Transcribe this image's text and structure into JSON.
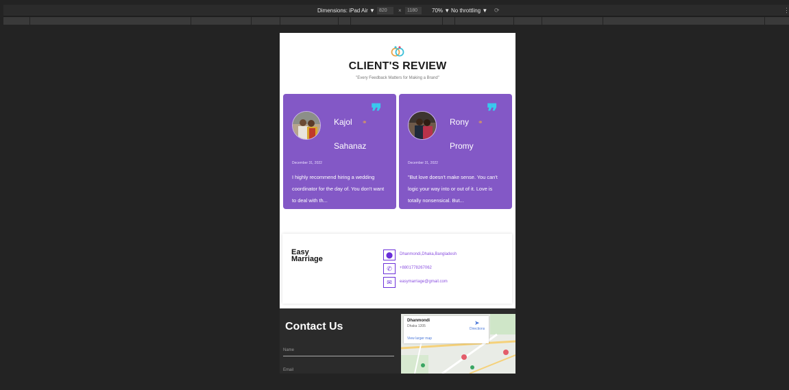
{
  "toolbar": {
    "dimensions": "Dimensions: iPad Air ▼",
    "width": "820",
    "times": "×",
    "height": "1180",
    "zoom": "70% ▼",
    "throttling": "No throttling ▼",
    "more": "⋮"
  },
  "review": {
    "title": "CLIENT'S REVIEW",
    "subtitle": "\"Every Feedback Matters for Making a Brand\"",
    "cards": [
      {
        "first_name": "Kajol",
        "second_name": "Sahanaz",
        "date": "December 31, 2022",
        "text": "I highly recommend hiring a wedding coordinator for the day of. You don't want to deal with th..."
      },
      {
        "first_name": "Rony",
        "second_name": "Promy",
        "date": "December 31, 2022",
        "text": "\"But love doesn't make sense. You can't logic your way into or out of it. Love is totally nonsensical. But..."
      }
    ]
  },
  "footer": {
    "brand_line1": "Easy",
    "brand_line2": "Marriage",
    "address": "Dhanmondi,Dhaka,Bangladesh",
    "phone": "+8801778267062",
    "email": "easymarriage@gmail.com"
  },
  "contact": {
    "title": "Contact Us",
    "name_placeholder": "Name",
    "email_placeholder": "Email"
  },
  "map": {
    "place": "Dhanmondi",
    "area": "Dhaka 1205",
    "directions": "Directions",
    "larger_map": "View larger map"
  },
  "colors": {
    "card": "#8358c6",
    "quote": "#38c9ee",
    "accent": "#6a2fd9"
  }
}
